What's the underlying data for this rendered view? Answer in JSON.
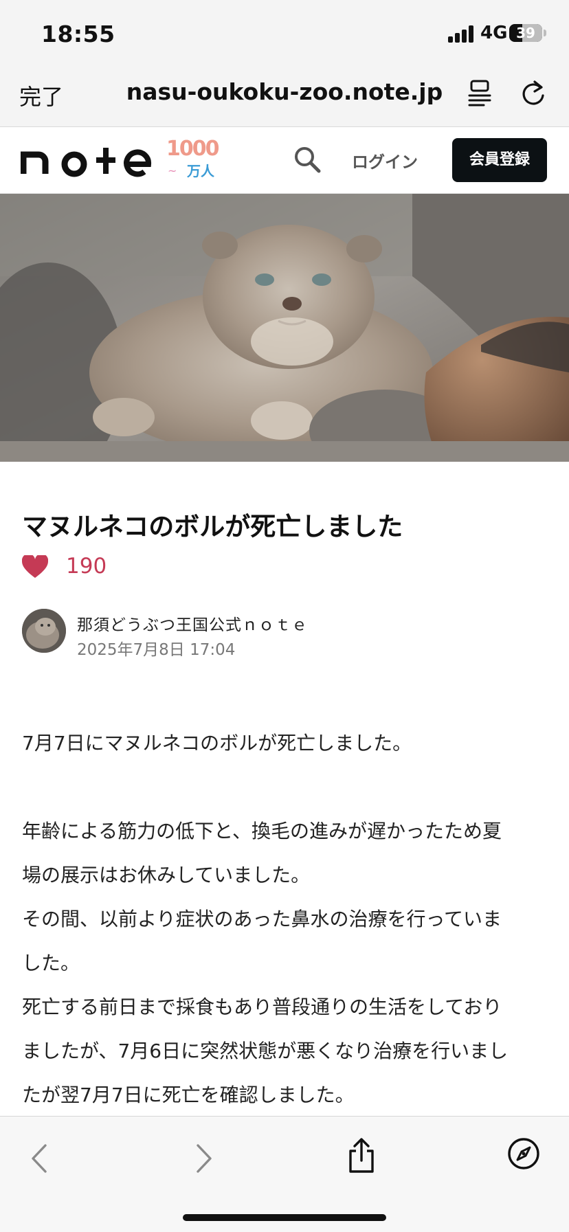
{
  "status_bar": {
    "time": "18:55",
    "network": "4G",
    "battery_level": "39",
    "battery_fraction": 0.39
  },
  "browser": {
    "done_label": "完了",
    "url": "nasu-oukoku-zoo.note.jp",
    "icons": [
      "reader-mode-icon",
      "reload-icon",
      "back-icon",
      "forward-icon",
      "share-icon",
      "compass-icon"
    ]
  },
  "site_header": {
    "logo_text": "note",
    "badge_number": "1000",
    "badge_unit": "万人",
    "login_label": "ログイン",
    "signup_label": "会員登録"
  },
  "article": {
    "title": "マヌルネコのボルが死亡しました",
    "like_count": "190",
    "author": "那須どうぶつ王国公式ｎｏｔｅ",
    "date": "2025年7月8日 17:04",
    "paragraphs": [
      "7月7日にマヌルネコのボルが死亡しました。",
      "",
      "年齢による筋力の低下と、換毛の進みが遅かったため夏",
      "場の展示はお休みしていました。",
      "その間、以前より症状のあった鼻水の治療を行っていま",
      "した。",
      "死亡する前日まで採食もあり普段通りの生活をしており",
      "ましたが、7月6日に突然状態が悪くなり治療を行いまし",
      "たが翌7月7日に死亡を確認しました。"
    ]
  },
  "colors": {
    "accent_like": "#c53a55",
    "signup_bg": "#0c1114",
    "chrome_bg": "#f4f4f4"
  }
}
